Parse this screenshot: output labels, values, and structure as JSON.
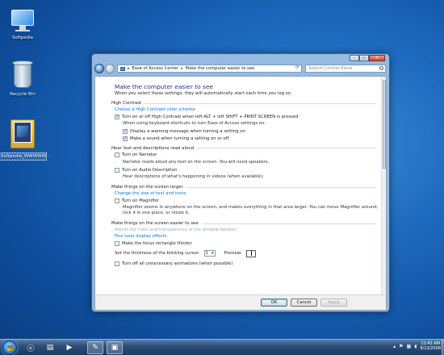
{
  "desktop": {
    "icons": [
      {
        "label": "Softpedia"
      },
      {
        "label": "Recycle Bin"
      },
      {
        "label": "Softpedia_WWWWW..."
      }
    ]
  },
  "window": {
    "breadcrumb": [
      "Ease of Access Center",
      "Make the computer easier to see"
    ],
    "search_placeholder": "Search Control Panel",
    "controls": {
      "minimize": "–",
      "maximize": "▭",
      "close": "✕"
    },
    "page_title": "Make the computer easier to see",
    "page_desc": "When you select these settings, they will automatically start each time you log on.",
    "sections": {
      "high_contrast": {
        "heading": "High Contrast",
        "link": "Choose a High Contrast color scheme",
        "main_checkbox": {
          "label": "Turn on or off High Contrast when left ALT + left SHIFT + PRINT SCREEN is pressed",
          "checked": true
        },
        "sub_label": "When using keyboard shortcuts to turn Ease of Access settings on:",
        "sub_options": [
          {
            "label": "Display a warning message when turning a setting on",
            "checked": true
          },
          {
            "label": "Make a sound when turning a setting on or off",
            "checked": true
          }
        ]
      },
      "hear_text": {
        "heading": "Hear text and descriptions read aloud",
        "narrator": {
          "label": "Turn on Narrator",
          "checked": false,
          "note": "Narrator reads aloud any text on the screen. You will need speakers."
        },
        "audio_desc": {
          "label": "Turn on Audio Description",
          "checked": false,
          "note": "Hear descriptions of what's happening in videos (when available)."
        }
      },
      "larger": {
        "heading": "Make things on the screen larger",
        "link": "Change the size of text and icons",
        "magnifier": {
          "label": "Turn on Magnifier",
          "checked": false,
          "note": "Magnifier zooms in anywhere on the screen, and makes everything in that area larger. You can move Magnifier around, lock it in one place, or resize it."
        }
      },
      "easier": {
        "heading": "Make things on the screen easier to see",
        "link_disabled": "Adjust the color and transparency of the window borders",
        "link": "Fine tune display effects",
        "focus": {
          "label": "Make the focus rectangle thicker",
          "checked": false
        },
        "cursor_label": "Set the thickness of the blinking cursor:",
        "cursor_value": "1",
        "preview_label": "Preview:",
        "animations": {
          "label": "Turn off all unnecessary animations (when possible)",
          "checked": false
        }
      }
    },
    "buttons": {
      "ok": "OK",
      "cancel": "Cancel",
      "apply": "Apply"
    }
  },
  "taskbar": {
    "clock_time": "11:43 AM",
    "clock_date": "8/13/2008"
  }
}
